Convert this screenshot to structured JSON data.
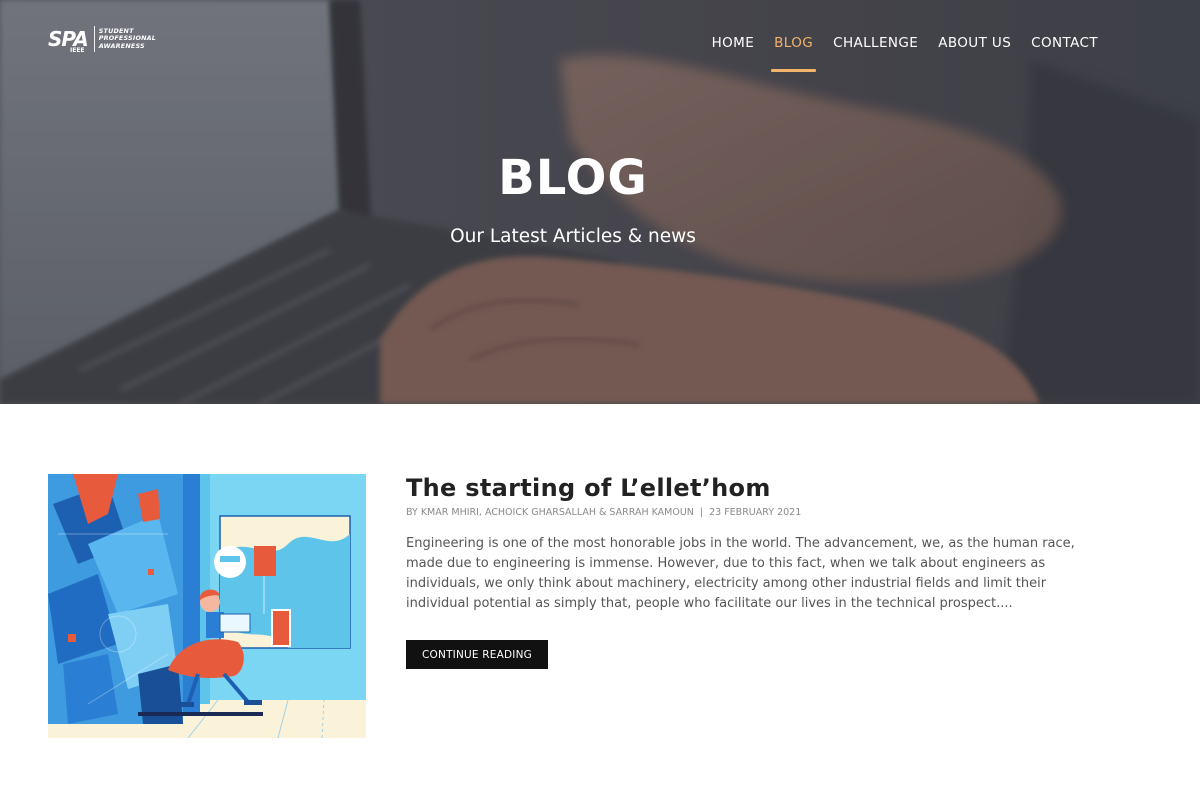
{
  "logo": {
    "mark": "SPA",
    "sub": "IEEE",
    "line1": "STUDENT",
    "line2": "PROFESSIONAL",
    "line3": "AWARENESS"
  },
  "nav": {
    "items": [
      {
        "label": "HOME",
        "active": false
      },
      {
        "label": "BLOG",
        "active": true
      },
      {
        "label": "CHALLENGE",
        "active": false
      },
      {
        "label": "ABOUT US",
        "active": false
      },
      {
        "label": "CONTACT",
        "active": false
      }
    ]
  },
  "hero": {
    "title": "BLOG",
    "subtitle": "Our Latest Articles & news"
  },
  "post": {
    "title": "The starting of L’ellet’hom",
    "authors": "BY KMAR MHIRI, ACHOICK GHARSALLAH & SARRAH KAMOUN",
    "separator": "|",
    "date": "23 FEBRUARY 2021",
    "excerpt": "Engineering is one of the most honorable jobs in the world. The advancement, we, as the human race, made due to engineering is immense. However, due to this fact, when we talk about engineers as individuals, we only think about machinery, electricity among other industrial fields and limit their individual potential as simply that, people who facilitate our lives in the technical prospect....",
    "button": "CONTINUE READING"
  },
  "colors": {
    "accent": "#f2b36b",
    "button_bg": "#111111",
    "illustration_sky": "#7ad6f3",
    "illustration_cream": "#fbf3d9",
    "illustration_blue": "#2a7fd4",
    "illustration_red": "#e85a3c"
  }
}
